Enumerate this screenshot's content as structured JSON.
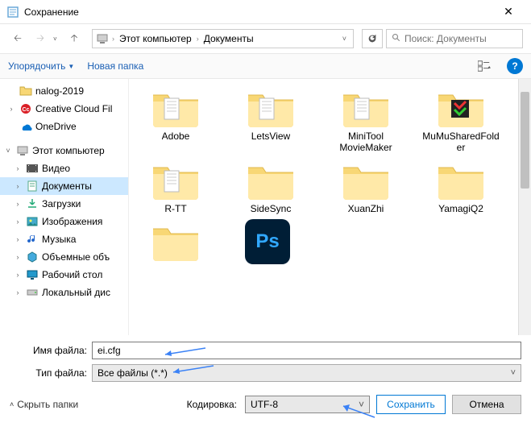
{
  "window": {
    "title": "Сохранение"
  },
  "breadcrumb": {
    "root": "Этот компьютер",
    "current": "Документы"
  },
  "search": {
    "placeholder": "Поиск: Документы"
  },
  "toolbar": {
    "organize": "Упорядочить",
    "new_folder": "Новая папка"
  },
  "sidebar": {
    "items": [
      {
        "label": "nalog-2019",
        "icon": "folder",
        "level": 1,
        "expander": ""
      },
      {
        "label": "Creative Cloud Fil",
        "icon": "cc",
        "level": 1,
        "expander": "›"
      },
      {
        "label": "OneDrive",
        "icon": "onedrive",
        "level": 1,
        "expander": ""
      },
      {
        "label": "Этот компьютер",
        "icon": "pc",
        "level": 0,
        "expander": "˅"
      },
      {
        "label": "Видео",
        "icon": "video",
        "level": 2,
        "expander": "›"
      },
      {
        "label": "Документы",
        "icon": "docs",
        "level": 2,
        "expander": "›",
        "selected": true
      },
      {
        "label": "Загрузки",
        "icon": "downloads",
        "level": 2,
        "expander": "›"
      },
      {
        "label": "Изображения",
        "icon": "images",
        "level": 2,
        "expander": "›"
      },
      {
        "label": "Музыка",
        "icon": "music",
        "level": 2,
        "expander": "›"
      },
      {
        "label": "Объемные объ",
        "icon": "3d",
        "level": 2,
        "expander": "›"
      },
      {
        "label": "Рабочий стол",
        "icon": "desktop",
        "level": 2,
        "expander": "›"
      },
      {
        "label": "Локальный дис",
        "icon": "disk",
        "level": 2,
        "expander": "›"
      }
    ]
  },
  "folders": [
    {
      "label": "Adobe",
      "type": "docfolder"
    },
    {
      "label": "LetsView",
      "type": "docfolder"
    },
    {
      "label": "MiniTool MovieMaker",
      "type": "docfolder"
    },
    {
      "label": "MuMuSharedFolder",
      "type": "colorfolder"
    },
    {
      "label": "R-TT",
      "type": "docfolder"
    },
    {
      "label": "SideSync",
      "type": "folder"
    },
    {
      "label": "XuanZhi",
      "type": "folder"
    },
    {
      "label": "YamagiQ2",
      "type": "folder"
    },
    {
      "label": "",
      "type": "folder"
    },
    {
      "label": "",
      "type": "ps"
    }
  ],
  "fields": {
    "filename_label_pre": "Имя файла:",
    "filename_value": "ei.cfg",
    "filetype_label_pre": "Тип файла:",
    "filetype_value": "Все файлы  (*.*)"
  },
  "actions": {
    "hide_folders": "Скрыть папки",
    "encoding_label": "Кодировка:",
    "encoding_value": "UTF-8",
    "save": "Сохранить",
    "cancel": "Отмена"
  }
}
